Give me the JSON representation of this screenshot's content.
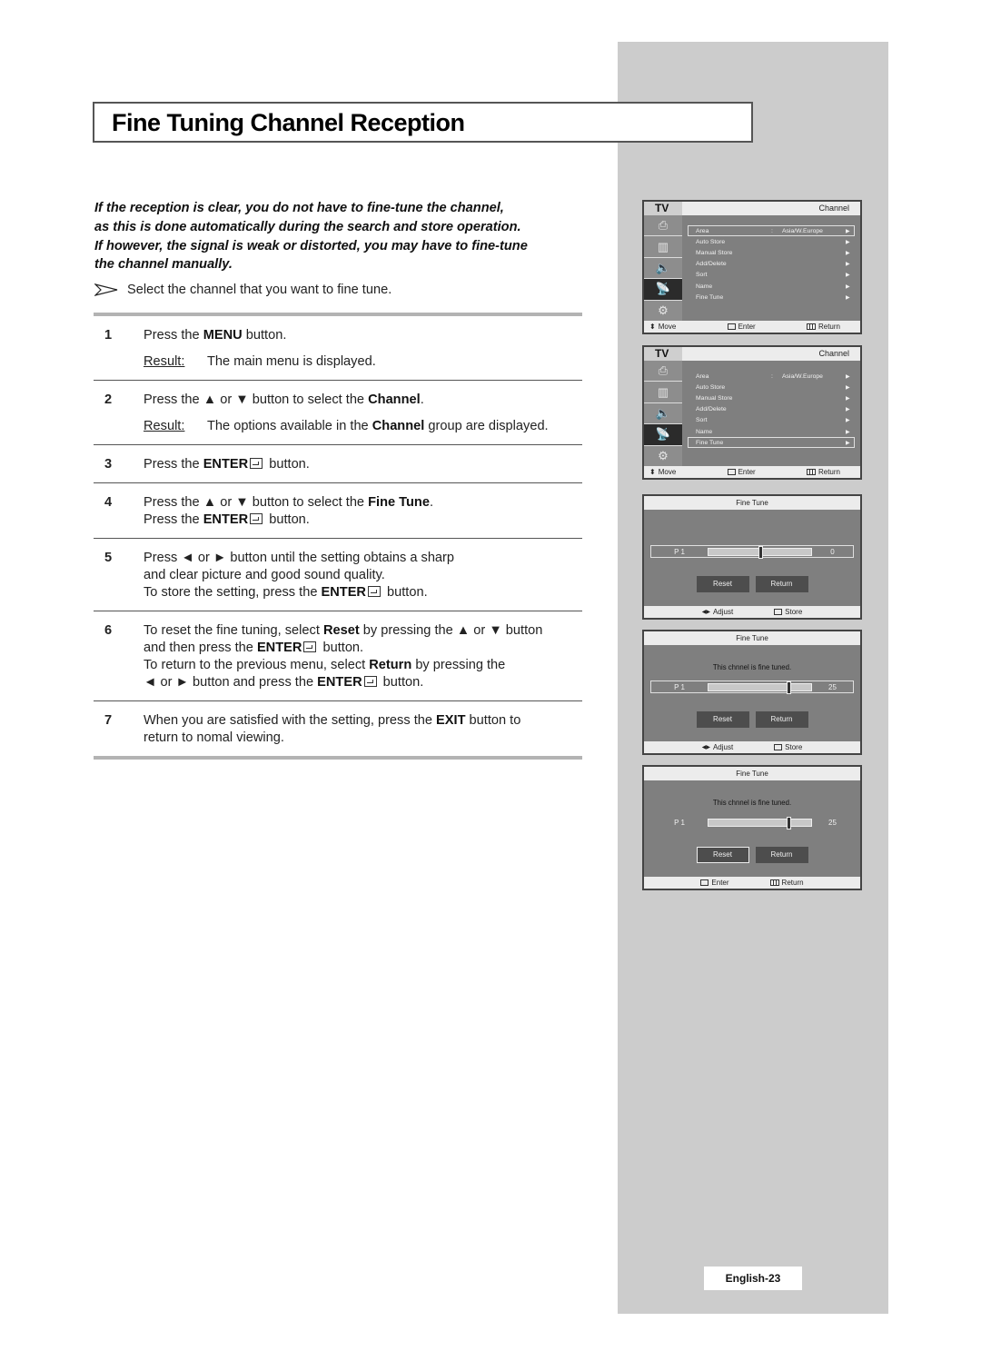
{
  "title": "Fine Tuning Channel Reception",
  "intro": [
    "If the reception is clear, you do not have to fine-tune the channel,",
    "as this is done automatically during the search and store operation.",
    "If however, the signal is weak or distorted, you may have to fine-tune",
    "the channel manually."
  ],
  "note": "Select the channel that you want to fine tune.",
  "steps": [
    {
      "num": "1",
      "lines": [
        [
          "Press the ",
          {
            "b": "MENU"
          },
          " button."
        ]
      ],
      "result_label": "Result:",
      "result": [
        "The main menu is displayed."
      ]
    },
    {
      "num": "2",
      "lines": [
        [
          "Press the ▲ or ▼ button to select the ",
          {
            "b": "Channel"
          },
          "."
        ]
      ],
      "result_label": "Result:",
      "result": [
        "The options available in the ",
        {
          "b": "Channel"
        },
        " group are displayed."
      ]
    },
    {
      "num": "3",
      "lines": [
        [
          "Press the ",
          {
            "b": "ENTER"
          },
          {
            "enter": true
          },
          " button."
        ]
      ]
    },
    {
      "num": "4",
      "lines": [
        [
          "Press the ▲ or ▼ button to select the ",
          {
            "b": "Fine Tune"
          },
          "."
        ],
        [
          "Press the ",
          {
            "b": "ENTER"
          },
          {
            "enter": true
          },
          " button."
        ]
      ]
    },
    {
      "num": "5",
      "lines": [
        [
          "Press ◄ or ► button until the setting obtains a sharp"
        ],
        [
          "and clear picture and good sound quality."
        ],
        [
          "To store the setting, press the ",
          {
            "b": "ENTER"
          },
          {
            "enter": true
          },
          " button."
        ]
      ]
    },
    {
      "num": "6",
      "lines": [
        [
          "To reset the fine tuning, select ",
          {
            "b": "Reset"
          },
          " by pressing the ▲ or ▼ button"
        ],
        [
          "and then press the ",
          {
            "b": "ENTER"
          },
          {
            "enter": true
          },
          " button."
        ],
        [
          "To return to the previous menu, select ",
          {
            "b": "Return"
          },
          " by pressing the"
        ],
        [
          "◄ or ► button and press the ",
          {
            "b": "ENTER"
          },
          {
            "enter": true
          },
          " button."
        ]
      ]
    },
    {
      "num": "7",
      "lines": [
        [
          "When you are satisfied with the setting, press the ",
          {
            "b": "EXIT"
          },
          " button to"
        ],
        [
          "return to nomal viewing."
        ]
      ]
    }
  ],
  "tv_menu": {
    "tv_label": "TV",
    "title": "Channel",
    "icons": [
      "input-icon",
      "picture-icon",
      "sound-icon",
      "channel-icon",
      "setup-icon"
    ],
    "items": [
      {
        "label": "Area",
        "value": "Asia/W.Europe"
      },
      {
        "label": "Auto Store",
        "value": ""
      },
      {
        "label": "Manual Store",
        "value": ""
      },
      {
        "label": "Add/Delete",
        "value": ""
      },
      {
        "label": "Sort",
        "value": ""
      },
      {
        "label": "Name",
        "value": ""
      },
      {
        "label": "Fine Tune",
        "value": ""
      }
    ],
    "footer": {
      "move": "Move",
      "enter": "Enter",
      "return": "Return"
    }
  },
  "screens_menu": [
    {
      "selected_index": 0
    },
    {
      "selected_index": 6
    }
  ],
  "fine_tune_screens": [
    {
      "title": "Fine Tune",
      "message": "",
      "channel": "P 1",
      "value": "0",
      "slider_fraction": 0.5,
      "slider_selected": true,
      "reset": "Reset",
      "return": "Return",
      "focused_button": "",
      "footer": [
        {
          "icon": "lr-arrows",
          "label": "Adjust"
        },
        {
          "icon": "enter",
          "label": "Store"
        }
      ]
    },
    {
      "title": "Fine Tune",
      "message": "This chnnel is fine tuned.",
      "channel": "P 1",
      "value": "25",
      "slider_fraction": 0.78,
      "slider_selected": true,
      "reset": "Reset",
      "return": "Return",
      "focused_button": "",
      "footer": [
        {
          "icon": "lr-arrows",
          "label": "Adjust"
        },
        {
          "icon": "enter",
          "label": "Store"
        }
      ]
    },
    {
      "title": "Fine Tune",
      "message": "This chnnel is fine tuned.",
      "channel": "P 1",
      "value": "25",
      "slider_fraction": 0.78,
      "slider_selected": false,
      "reset": "Reset",
      "return": "Return",
      "focused_button": "reset",
      "footer": [
        {
          "icon": "enter",
          "label": "Enter"
        },
        {
          "icon": "menu",
          "label": "Return"
        }
      ]
    }
  ],
  "page_number": "English-23"
}
